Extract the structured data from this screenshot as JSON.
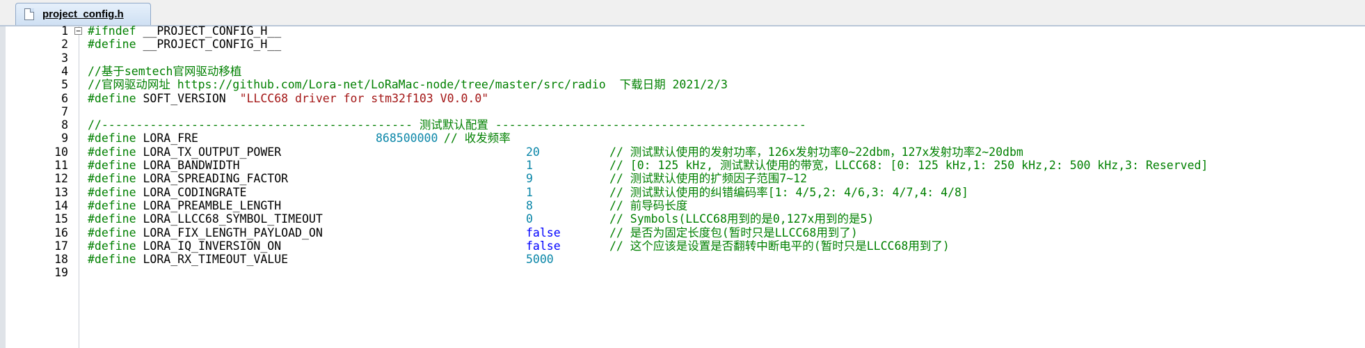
{
  "tab": {
    "label": "project_config.h"
  },
  "lines": [
    {
      "n": "1",
      "pp": "#ifndef",
      "id": " __PROJECT_CONFIG_H__"
    },
    {
      "n": "2",
      "pp": "#define",
      "id": " __PROJECT_CONFIG_H__"
    },
    {
      "n": "3"
    },
    {
      "n": "4",
      "cm": "//基于semtech官网驱动移植"
    },
    {
      "n": "5",
      "cm": "//官网驱动网址 https://github.com/Lora-net/LoRaMac-node/tree/master/src/radio  下载日期 2021/2/3"
    },
    {
      "n": "6",
      "pp": "#define",
      "id": " SOFT_VERSION  ",
      "str": "\"LLCC68 driver for stm32f103 V0.0.0\""
    },
    {
      "n": "7"
    },
    {
      "n": "8",
      "cm": "//--------------------------------------------- 测试默认配置 ---------------------------------------------"
    },
    {
      "n": "9",
      "pp": "#define",
      "id": " LORA_FRE",
      "val": "868500000",
      "vclass": "num",
      "vpos": "near",
      "cm2": " // 收发频率"
    },
    {
      "n": "10",
      "pp": "#define",
      "id": " LORA_TX_OUTPUT_POWER",
      "val": "20",
      "vclass": "num",
      "cm2": "// 测试默认使用的发射功率，126x发射功率0~22dbm，127x发射功率2~20dbm"
    },
    {
      "n": "11",
      "pp": "#define",
      "id": " LORA_BANDWIDTH",
      "val": "1",
      "vclass": "num",
      "cm2": "// [0: 125 kHz, 测试默认使用的带宽，LLCC68: [0: 125 kHz,1: 250 kHz,2: 500 kHz,3: Reserved]"
    },
    {
      "n": "12",
      "pp": "#define",
      "id": " LORA_SPREADING_FACTOR",
      "val": "9",
      "vclass": "num",
      "cm2": "// 测试默认使用的扩频因子范围7~12"
    },
    {
      "n": "13",
      "pp": "#define",
      "id": " LORA_CODINGRATE",
      "val": "1",
      "vclass": "num",
      "cm2": "// 测试默认使用的纠错编码率[1: 4/5,2: 4/6,3: 4/7,4: 4/8]"
    },
    {
      "n": "14",
      "pp": "#define",
      "id": " LORA_PREAMBLE_LENGTH",
      "val": "8",
      "vclass": "num",
      "cm2": "// 前导码长度"
    },
    {
      "n": "15",
      "pp": "#define",
      "id": " LORA_LLCC68_SYMBOL_TIMEOUT",
      "val": "0",
      "vclass": "num",
      "cm2": "// Symbols(LLCC68用到的是0,127x用到的是5)"
    },
    {
      "n": "16",
      "pp": "#define",
      "id": " LORA_FIX_LENGTH_PAYLOAD_ON",
      "val": "false",
      "vclass": "kw",
      "cm2": "// 是否为固定长度包(暂时只是LLCC68用到了)"
    },
    {
      "n": "17",
      "pp": "#define",
      "id": " LORA_IQ_INVERSION_ON",
      "val": "false",
      "vclass": "kw",
      "cm2": "// 这个应该是设置是否翻转中断电平的(暂时只是LLCC68用到了)"
    },
    {
      "n": "18",
      "pp": "#define",
      "id": " LORA_RX_TIMEOUT_VALUE",
      "val": "5000",
      "vclass": "num"
    },
    {
      "n": "19"
    }
  ]
}
